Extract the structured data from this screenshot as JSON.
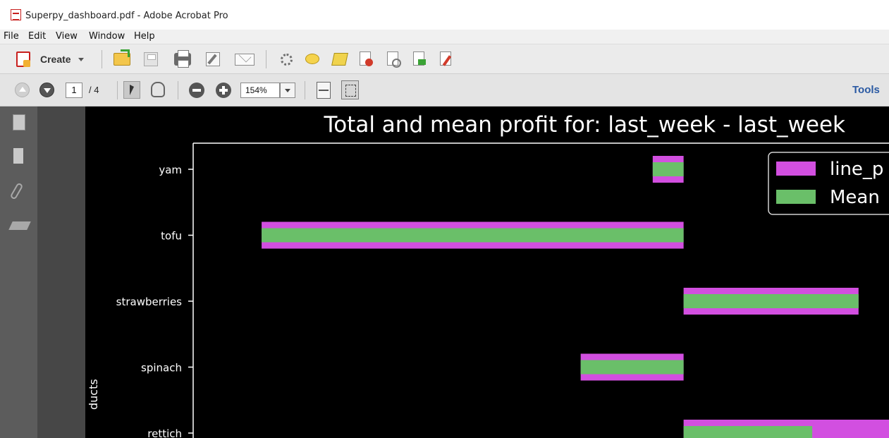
{
  "window": {
    "title": "Superpy_dashboard.pdf - Adobe Acrobat Pro"
  },
  "menu": {
    "items": [
      "File",
      "Edit",
      "View",
      "Window",
      "Help"
    ]
  },
  "toolbar": {
    "create_label": "Create",
    "icons": [
      "open-icon",
      "save-icon",
      "print-icon",
      "edit-icon",
      "email-icon",
      "settings-icon",
      "comment-icon",
      "highlight-icon",
      "delete-icon",
      "review-icon",
      "export-icon",
      "sign-icon"
    ]
  },
  "nav": {
    "current_page": "1",
    "total_pages": "/ 4",
    "zoom": "154%",
    "tools_label": "Tools"
  },
  "sidepanel": {
    "icons": [
      "pages-icon",
      "bookmarks-icon",
      "attachments-icon",
      "signatures-icon"
    ]
  },
  "chart_data": {
    "type": "bar",
    "orientation": "horizontal",
    "title": "Total and mean profit for: last_week - last_week",
    "ylabel": "ducts",
    "categories": [
      "yam",
      "tofu",
      "strawberries",
      "spinach",
      "rettich"
    ],
    "series": [
      {
        "name": "line_p",
        "color": "#d24fe0",
        "values": [
          -0.6,
          -8.2,
          3.4,
          -2.0,
          6.0
        ]
      },
      {
        "name": "Mean",
        "color": "#6abf69",
        "values": [
          -0.6,
          -8.2,
          3.4,
          -2.0,
          2.5
        ]
      }
    ],
    "xlim": [
      -8.9,
      4.8
    ],
    "background": "#000000",
    "legend_position": "top-right"
  }
}
